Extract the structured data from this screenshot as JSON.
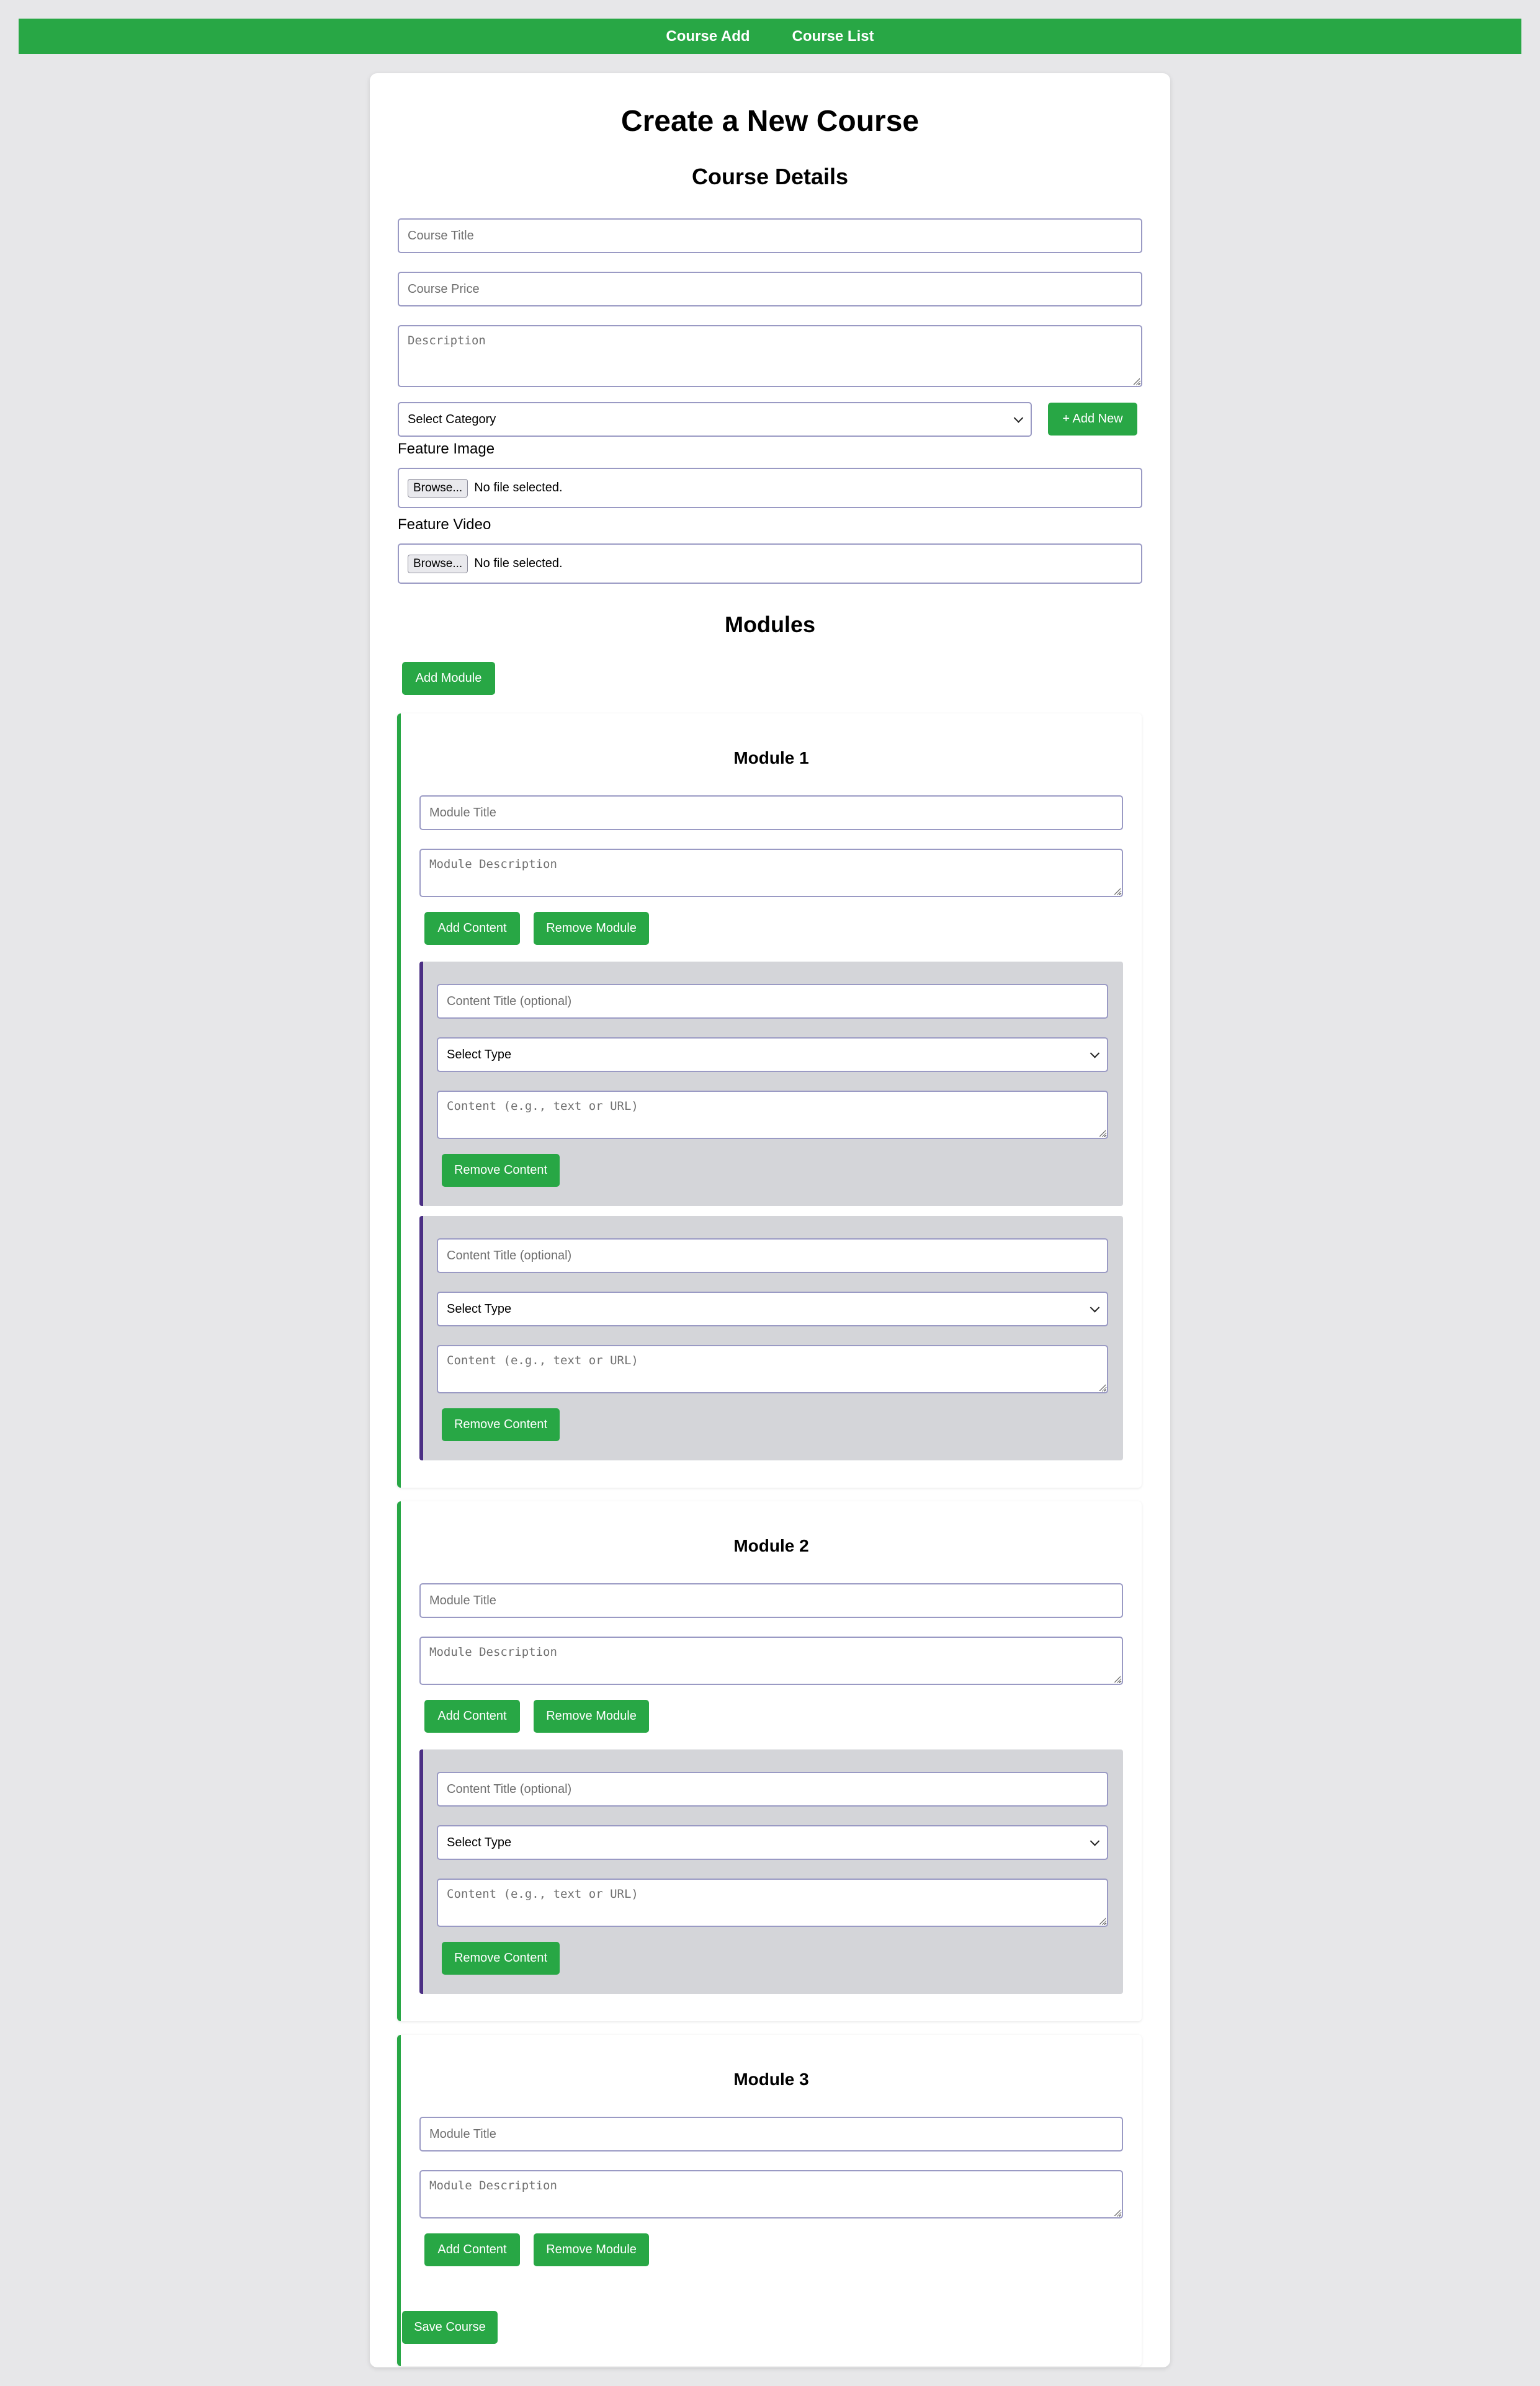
{
  "nav": {
    "links": [
      "Course Add",
      "Course List"
    ]
  },
  "page": {
    "title": "Create a New Course",
    "details_heading": "Course Details",
    "modules_heading": "Modules"
  },
  "course": {
    "title_placeholder": "Course Title",
    "price_placeholder": "Course Price",
    "description_placeholder": "Description",
    "category_selected": "Select Category",
    "add_new_label": "+ Add New",
    "feature_image_label": "Feature Image",
    "feature_video_label": "Feature Video",
    "browse_label": "Browse...",
    "no_file_text": "No file selected."
  },
  "module_actions": {
    "add_module": "Add Module",
    "add_content": "Add Content",
    "remove_module": "Remove Module",
    "remove_content": "Remove Content",
    "save_course": "Save Course"
  },
  "module_fields": {
    "title_placeholder": "Module Title",
    "description_placeholder": "Module Description"
  },
  "content_fields": {
    "title_placeholder": "Content Title (optional)",
    "type_selected": "Select Type",
    "body_placeholder": "Content (e.g., text or URL)"
  },
  "modules": [
    {
      "title": "Module 1",
      "content_count": 2
    },
    {
      "title": "Module 2",
      "content_count": 1
    },
    {
      "title": "Module 3",
      "content_count": 0
    }
  ],
  "colors": {
    "accent": "#28a745",
    "content_border": "#4b2f84",
    "content_bg": "#d4d5d9",
    "page_bg": "#e7e7e9"
  }
}
